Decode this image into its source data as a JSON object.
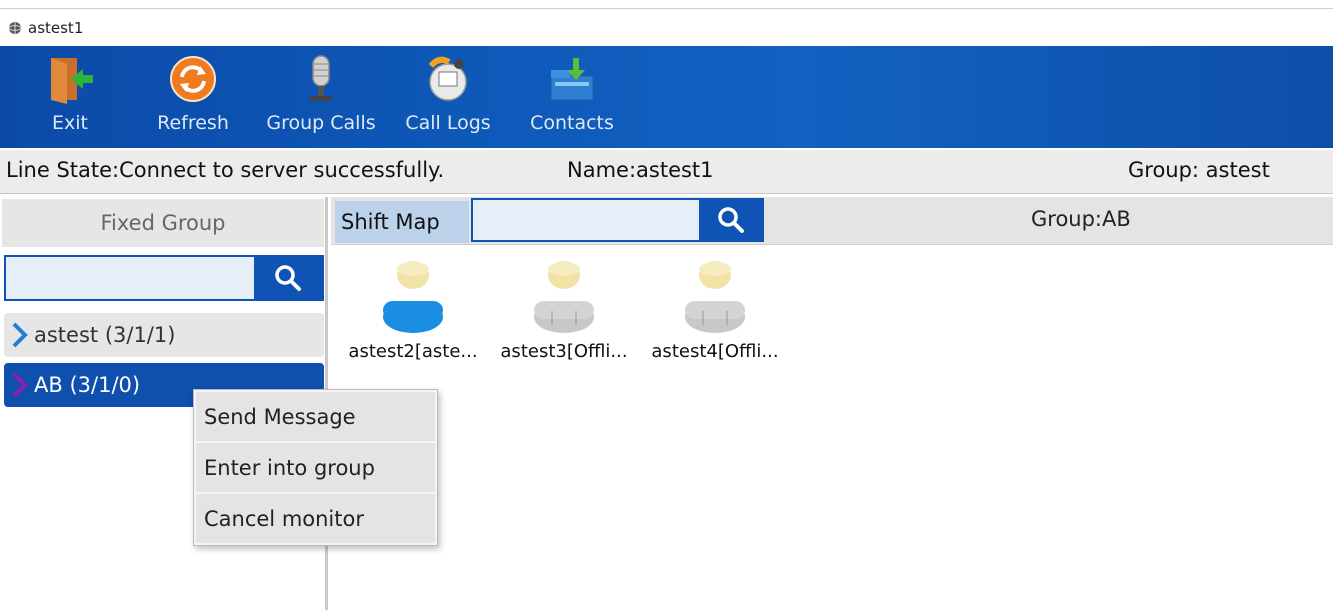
{
  "window": {
    "title": "astest1",
    "icon": "app-globe-icon"
  },
  "toolbar": {
    "buttons": [
      {
        "label": "Exit",
        "icon": "exit-door-icon"
      },
      {
        "label": "Refresh",
        "icon": "refresh-icon"
      },
      {
        "label": "Group Calls",
        "icon": "microphone-icon"
      },
      {
        "label": "Call Logs",
        "icon": "call-logs-icon"
      },
      {
        "label": "Contacts",
        "icon": "contacts-icon"
      }
    ]
  },
  "status": {
    "line_state": "Line State:Connect to server successfully.",
    "name": "Name:astest1",
    "group": "Group: astest"
  },
  "left": {
    "header": "Fixed Group",
    "search_placeholder": "",
    "groups": [
      {
        "label": "astest (3/1/1)",
        "selected": false
      },
      {
        "label": "AB (3/1/0)",
        "selected": true
      }
    ]
  },
  "context_menu": {
    "items": [
      "Send Message",
      "Enter into group",
      "Cancel monitor"
    ]
  },
  "right": {
    "shift_map_label": "Shift Map",
    "search_placeholder": "",
    "group_label": "Group:AB",
    "members": [
      {
        "label": "astest2[aste...",
        "status": "online"
      },
      {
        "label": "astest3[Offli...",
        "status": "offline"
      },
      {
        "label": "astest4[Offli...",
        "status": "offline"
      }
    ]
  },
  "colors": {
    "toolbar_blue": "#0e58b8",
    "selected_blue": "#0f4fae",
    "online_blue": "#1a8ee0",
    "offline_gray": "#c8c8c8",
    "chevron_blue": "#1e7fd6",
    "chevron_purple": "#8a1fb0"
  }
}
